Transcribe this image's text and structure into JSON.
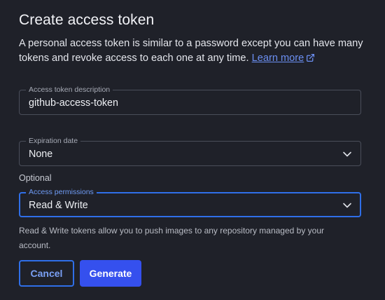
{
  "dialog": {
    "title": "Create access token",
    "description": "A personal access token is similar to a password except you can have many tokens and revoke access to each one at any time.",
    "learn_more_label": "Learn more",
    "learn_more_icon": "external-link-icon"
  },
  "fields": {
    "description": {
      "label": "Access token description",
      "value": "github-access-token"
    },
    "expiration": {
      "label": "Expiration date",
      "value": "None",
      "icon": "chevron-down-icon"
    },
    "optional_label": "Optional",
    "permissions": {
      "label": "Access permissions",
      "value": "Read & Write",
      "icon": "chevron-down-icon"
    }
  },
  "permissions_help": "Read & Write tokens allow you to push images to any repository managed by your account.",
  "buttons": {
    "cancel_label": "Cancel",
    "generate_label": "Generate"
  },
  "colors": {
    "background": "#1f2129",
    "accent": "#2f6fe8",
    "primary_button": "#3550ee",
    "link": "#6b8ff2"
  }
}
